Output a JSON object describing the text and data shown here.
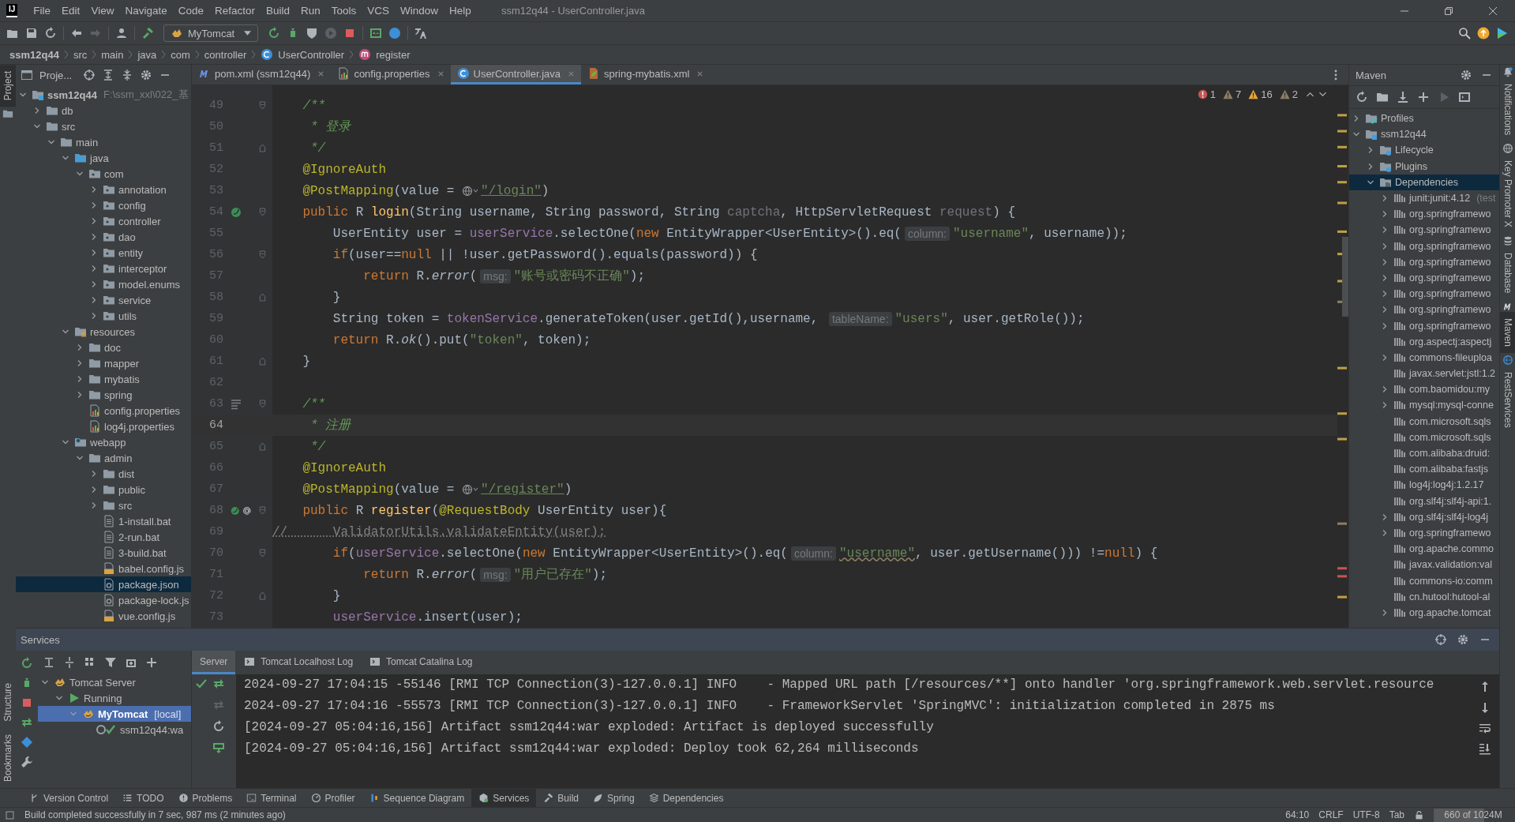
{
  "title_bar": {
    "logo": "IJ",
    "menu": [
      "File",
      "Edit",
      "View",
      "Navigate",
      "Code",
      "Refactor",
      "Build",
      "Run",
      "Tools",
      "VCS",
      "Window",
      "Help"
    ],
    "title": "ssm12q44 - UserController.java"
  },
  "toolbar": {
    "run_config": "MyTomcat"
  },
  "breadcrumb": [
    {
      "label": "ssm12q44",
      "kind": "root"
    },
    {
      "label": "src",
      "kind": "dir"
    },
    {
      "label": "main",
      "kind": "dir"
    },
    {
      "label": "java",
      "kind": "dir"
    },
    {
      "label": "com",
      "kind": "dir"
    },
    {
      "label": "controller",
      "kind": "dir"
    },
    {
      "label": "UserController",
      "kind": "class"
    },
    {
      "label": "register",
      "kind": "method"
    }
  ],
  "left_stripe": {
    "top": [
      {
        "label": "Project",
        "selected": true
      }
    ],
    "bottom": [
      {
        "label": "Structure",
        "selected": false
      },
      {
        "label": "Bookmarks",
        "selected": false
      }
    ]
  },
  "project": {
    "title": "Proje...",
    "tree": [
      {
        "label": "ssm12q44",
        "hint": "F:\\ssm_xxl\\022_基",
        "kind": "module",
        "expanded": true,
        "selected": false,
        "children": [
          {
            "label": "db",
            "kind": "folder",
            "expanded": false,
            "selected": false
          },
          {
            "label": "src",
            "kind": "folder",
            "expanded": true,
            "selected": false,
            "children": [
              {
                "label": "main",
                "kind": "folder",
                "expanded": true,
                "selected": false,
                "children": [
                  {
                    "label": "java",
                    "kind": "source",
                    "expanded": true,
                    "selected": false,
                    "children": [
                      {
                        "label": "com",
                        "kind": "package",
                        "expanded": true,
                        "selected": false,
                        "children": [
                          {
                            "label": "annotation",
                            "kind": "package",
                            "expanded": false,
                            "selected": false
                          },
                          {
                            "label": "config",
                            "kind": "package",
                            "expanded": false,
                            "selected": false
                          },
                          {
                            "label": "controller",
                            "kind": "package",
                            "expanded": false,
                            "selected": false
                          },
                          {
                            "label": "dao",
                            "kind": "package",
                            "expanded": false,
                            "selected": false
                          },
                          {
                            "label": "entity",
                            "kind": "package",
                            "expanded": false,
                            "selected": false
                          },
                          {
                            "label": "interceptor",
                            "kind": "package",
                            "expanded": false,
                            "selected": false
                          },
                          {
                            "label": "model.enums",
                            "kind": "package",
                            "expanded": false,
                            "selected": false
                          },
                          {
                            "label": "service",
                            "kind": "package",
                            "expanded": false,
                            "selected": false
                          },
                          {
                            "label": "utils",
                            "kind": "package",
                            "expanded": false,
                            "selected": false
                          }
                        ]
                      }
                    ]
                  },
                  {
                    "label": "resources",
                    "kind": "resources",
                    "expanded": true,
                    "selected": false,
                    "children": [
                      {
                        "label": "doc",
                        "kind": "folder",
                        "expanded": false,
                        "selected": false
                      },
                      {
                        "label": "mapper",
                        "kind": "folder",
                        "expanded": false,
                        "selected": false
                      },
                      {
                        "label": "mybatis",
                        "kind": "folder",
                        "expanded": false,
                        "selected": false
                      },
                      {
                        "label": "spring",
                        "kind": "folder",
                        "expanded": false,
                        "selected": false
                      },
                      {
                        "label": "config.properties",
                        "kind": "props",
                        "selected": false
                      },
                      {
                        "label": "log4j.properties",
                        "kind": "props",
                        "selected": false
                      }
                    ]
                  },
                  {
                    "label": "webapp",
                    "kind": "web",
                    "expanded": true,
                    "selected": false,
                    "children": [
                      {
                        "label": "admin",
                        "kind": "folder",
                        "expanded": true,
                        "selected": false,
                        "children": [
                          {
                            "label": "dist",
                            "kind": "folder",
                            "expanded": false,
                            "selected": false
                          },
                          {
                            "label": "public",
                            "kind": "folder",
                            "expanded": false,
                            "selected": false
                          },
                          {
                            "label": "src",
                            "kind": "folder",
                            "expanded": false,
                            "selected": false
                          },
                          {
                            "label": "1-install.bat",
                            "kind": "bat",
                            "selected": false
                          },
                          {
                            "label": "2-run.bat",
                            "kind": "bat",
                            "selected": false
                          },
                          {
                            "label": "3-build.bat",
                            "kind": "bat",
                            "selected": false
                          },
                          {
                            "label": "babel.config.js",
                            "kind": "js",
                            "selected": false
                          },
                          {
                            "label": "package.json",
                            "kind": "json",
                            "selected": true
                          },
                          {
                            "label": "package-lock.js",
                            "kind": "json",
                            "selected": false
                          },
                          {
                            "label": "vue.config.js",
                            "kind": "js",
                            "selected": false
                          }
                        ]
                      }
                    ]
                  }
                ]
              }
            ]
          }
        ]
      }
    ]
  },
  "tabs": [
    {
      "label": "pom.xml (ssm12q44)",
      "kind": "maven",
      "selected": false
    },
    {
      "label": "config.properties",
      "kind": "props",
      "selected": false
    },
    {
      "label": "UserController.java",
      "kind": "class",
      "selected": true
    },
    {
      "label": "spring-mybatis.xml",
      "kind": "spring",
      "selected": false
    }
  ],
  "inspections": [
    {
      "count": "1",
      "kind": "error"
    },
    {
      "count": "7",
      "kind": "weak"
    },
    {
      "count": "16",
      "kind": "warning"
    },
    {
      "count": "2",
      "kind": "weak"
    }
  ],
  "editor": {
    "lines": [
      {
        "number": "49",
        "fold_start": true,
        "current": false,
        "tokens": [
          {
            "text": "    /**",
            "kind": "doc"
          }
        ]
      },
      {
        "number": "50",
        "current": false,
        "tokens": [
          {
            "text": "     * 登录",
            "kind": "doc"
          }
        ]
      },
      {
        "number": "51",
        "fold_end": true,
        "current": false,
        "tokens": [
          {
            "text": "     */",
            "kind": "doc"
          }
        ]
      },
      {
        "number": "52",
        "current": false,
        "tokens": [
          {
            "text": "    @IgnoreAuth",
            "kind": "ann"
          }
        ]
      },
      {
        "number": "53",
        "current": false,
        "tokens": [
          {
            "text": "    @PostMapping",
            "kind": "ann"
          },
          {
            "text": "(value = ",
            "kind": "plain"
          },
          {
            "text": "\"/login\"",
            "kind": "url"
          },
          {
            "text": ")",
            "kind": "plain"
          }
        ]
      },
      {
        "number": "54",
        "gutter": [
          {
            "kind": "bean"
          }
        ],
        "fold_start": true,
        "current": false,
        "tokens": [
          {
            "text": "    public ",
            "kind": "kw"
          },
          {
            "text": "R ",
            "kind": "plain"
          },
          {
            "text": "login",
            "kind": "decl"
          },
          {
            "text": "(String username, String password, String ",
            "kind": "plain"
          },
          {
            "text": "captcha",
            "kind": "unused"
          },
          {
            "text": ", HttpServletRequest ",
            "kind": "plain"
          },
          {
            "text": "request",
            "kind": "unused"
          },
          {
            "text": ") {",
            "kind": "plain"
          }
        ]
      },
      {
        "number": "55",
        "current": false,
        "tokens": [
          {
            "text": "        UserEntity user = ",
            "kind": "plain"
          },
          {
            "text": "userService",
            "kind": "field"
          },
          {
            "text": ".selectOne(",
            "kind": "plain"
          },
          {
            "text": "new ",
            "kind": "kw"
          },
          {
            "text": "EntityWrapper<UserEntity>().eq(",
            "kind": "plain"
          },
          {
            "text": "column:",
            "kind": "hint"
          },
          {
            "text": "\"username\"",
            "kind": "str"
          },
          {
            "text": ", username));",
            "kind": "plain"
          }
        ]
      },
      {
        "number": "56",
        "fold_start": true,
        "current": false,
        "tokens": [
          {
            "text": "        if",
            "kind": "kw"
          },
          {
            "text": "(user==",
            "kind": "plain"
          },
          {
            "text": "null ",
            "kind": "kw"
          },
          {
            "text": "|| !user.getPassword().equals(password)) {",
            "kind": "plain"
          }
        ]
      },
      {
        "number": "57",
        "current": false,
        "tokens": [
          {
            "text": "            return ",
            "kind": "kw"
          },
          {
            "text": "R.",
            "kind": "plain"
          },
          {
            "text": "error",
            "kind": "static"
          },
          {
            "text": "(",
            "kind": "plain"
          },
          {
            "text": "msg:",
            "kind": "hint"
          },
          {
            "text": "\"账号或密码不正确\"",
            "kind": "str"
          },
          {
            "text": ");",
            "kind": "plain"
          }
        ]
      },
      {
        "number": "58",
        "fold_end": true,
        "current": false,
        "tokens": [
          {
            "text": "        }",
            "kind": "plain"
          }
        ]
      },
      {
        "number": "59",
        "current": false,
        "tokens": [
          {
            "text": "        String token = ",
            "kind": "plain"
          },
          {
            "text": "tokenService",
            "kind": "field"
          },
          {
            "text": ".generateToken(user.getId(),username, ",
            "kind": "plain"
          },
          {
            "text": "tableName:",
            "kind": "hint"
          },
          {
            "text": "\"users\"",
            "kind": "str"
          },
          {
            "text": ", user.getRole());",
            "kind": "plain"
          }
        ]
      },
      {
        "number": "60",
        "current": false,
        "tokens": [
          {
            "text": "        return ",
            "kind": "kw"
          },
          {
            "text": "R.",
            "kind": "plain"
          },
          {
            "text": "ok",
            "kind": "static"
          },
          {
            "text": "().put(",
            "kind": "plain"
          },
          {
            "text": "\"token\"",
            "kind": "str"
          },
          {
            "text": ", token);",
            "kind": "plain"
          }
        ]
      },
      {
        "number": "61",
        "fold_end": true,
        "current": false,
        "tokens": [
          {
            "text": "    }",
            "kind": "plain"
          }
        ]
      },
      {
        "number": "62",
        "current": false
      },
      {
        "number": "63",
        "gutter": [
          {
            "kind": "doc"
          }
        ],
        "fold_start": true,
        "current": false,
        "tokens": [
          {
            "text": "    /**",
            "kind": "doc"
          }
        ]
      },
      {
        "number": "64",
        "current": true,
        "tokens": [
          {
            "text": "     * 注册",
            "kind": "doc"
          }
        ]
      },
      {
        "number": "65",
        "fold_end": true,
        "current": false,
        "tokens": [
          {
            "text": "     */",
            "kind": "doc"
          }
        ]
      },
      {
        "number": "66",
        "current": false,
        "tokens": [
          {
            "text": "    @IgnoreAuth",
            "kind": "ann"
          }
        ]
      },
      {
        "number": "67",
        "current": false,
        "tokens": [
          {
            "text": "    @PostMapping",
            "kind": "ann"
          },
          {
            "text": "(value = ",
            "kind": "plain"
          },
          {
            "text": "\"/register\"",
            "kind": "url"
          },
          {
            "text": ")",
            "kind": "plain"
          }
        ]
      },
      {
        "number": "68",
        "gutter": [
          {
            "kind": "bean"
          },
          {
            "kind": "at"
          }
        ],
        "fold_start": true,
        "current": false,
        "tokens": [
          {
            "text": "    public ",
            "kind": "kw"
          },
          {
            "text": "R ",
            "kind": "plain"
          },
          {
            "text": "register",
            "kind": "decl"
          },
          {
            "text": "(",
            "kind": "plain"
          },
          {
            "text": "@RequestBody",
            "kind": "ann"
          },
          {
            "text": " UserEntity user){",
            "kind": "plain"
          }
        ]
      },
      {
        "number": "69",
        "current": false,
        "tokens": [
          {
            "text": "//      ValidatorUtils.validateEntity(user);",
            "kind": "comment"
          }
        ]
      },
      {
        "number": "70",
        "fold_start": true,
        "current": false,
        "tokens": [
          {
            "text": "        if",
            "kind": "kw"
          },
          {
            "text": "(",
            "kind": "plain"
          },
          {
            "text": "userService",
            "kind": "field"
          },
          {
            "text": ".selectOne(",
            "kind": "plain"
          },
          {
            "text": "new ",
            "kind": "kw"
          },
          {
            "text": "EntityWrapper<UserEntity>().eq(",
            "kind": "plain"
          },
          {
            "text": "column:",
            "kind": "hint"
          },
          {
            "text": "\"username\"",
            "kind": "strwarn"
          },
          {
            "text": ", user.getUsername())) !=",
            "kind": "plain"
          },
          {
            "text": "null",
            "kind": "kw"
          },
          {
            "text": ") {",
            "kind": "plain"
          }
        ]
      },
      {
        "number": "71",
        "current": false,
        "tokens": [
          {
            "text": "            return ",
            "kind": "kw"
          },
          {
            "text": "R.",
            "kind": "plain"
          },
          {
            "text": "error",
            "kind": "static"
          },
          {
            "text": "(",
            "kind": "plain"
          },
          {
            "text": "msg:",
            "kind": "hint"
          },
          {
            "text": "\"用户已存在\"",
            "kind": "str"
          },
          {
            "text": ");",
            "kind": "plain"
          }
        ]
      },
      {
        "number": "72",
        "fold_end": true,
        "current": false,
        "tokens": [
          {
            "text": "        }",
            "kind": "plain"
          }
        ]
      },
      {
        "number": "73",
        "current": false,
        "tokens": [
          {
            "text": "        userService",
            "kind": "field"
          },
          {
            "text": ".insert(user);",
            "kind": "plain"
          }
        ]
      }
    ]
  },
  "maven": {
    "title": "Maven",
    "tree": [
      {
        "label": "Profiles",
        "kind": "profiles",
        "expanded": false,
        "selected": false
      },
      {
        "label": "ssm12q44",
        "kind": "mvnmodule",
        "expanded": true,
        "selected": false,
        "children": [
          {
            "label": "Lifecycle",
            "kind": "lifecycle",
            "expanded": false,
            "selected": false
          },
          {
            "label": "Plugins",
            "kind": "lifecycle",
            "expanded": false,
            "selected": false
          },
          {
            "label": "Dependencies",
            "kind": "deps",
            "expanded": true,
            "selected": true,
            "children": [
              {
                "label": "junit:junit:4.12",
                "hint": "(test",
                "kind": "library",
                "expanded": false,
                "selected": false
              },
              {
                "label": "org.springframewo",
                "kind": "library",
                "expanded": false,
                "selected": false
              },
              {
                "label": "org.springframewo",
                "kind": "library",
                "expanded": false,
                "selected": false
              },
              {
                "label": "org.springframewo",
                "kind": "library",
                "expanded": false,
                "selected": false
              },
              {
                "label": "org.springframewo",
                "kind": "library",
                "expanded": false,
                "selected": false
              },
              {
                "label": "org.springframewo",
                "kind": "library",
                "expanded": false,
                "selected": false
              },
              {
                "label": "org.springframewo",
                "kind": "library",
                "expanded": false,
                "selected": false
              },
              {
                "label": "org.springframewo",
                "kind": "library",
                "expanded": false,
                "selected": false
              },
              {
                "label": "org.springframewo",
                "kind": "library",
                "expanded": false,
                "selected": false
              },
              {
                "label": "org.aspectj:aspectj",
                "kind": "library",
                "selected": false
              },
              {
                "label": "commons-fileuploa",
                "kind": "library",
                "expanded": false,
                "selected": false
              },
              {
                "label": "javax.servlet:jstl:1.2",
                "kind": "library",
                "selected": false
              },
              {
                "label": "com.baomidou:my",
                "kind": "library",
                "expanded": false,
                "selected": false
              },
              {
                "label": "mysql:mysql-conne",
                "kind": "library",
                "expanded": false,
                "selected": false
              },
              {
                "label": "com.microsoft.sqls",
                "kind": "library",
                "selected": false
              },
              {
                "label": "com.microsoft.sqls",
                "kind": "library",
                "selected": false
              },
              {
                "label": "com.alibaba:druid:",
                "kind": "library",
                "selected": false
              },
              {
                "label": "com.alibaba:fastjs",
                "kind": "library",
                "selected": false
              },
              {
                "label": "log4j:log4j:1.2.17",
                "kind": "library",
                "selected": false
              },
              {
                "label": "org.slf4j:slf4j-api:1.",
                "kind": "library",
                "selected": false
              },
              {
                "label": "org.slf4j:slf4j-log4j",
                "kind": "library",
                "expanded": false,
                "selected": false
              },
              {
                "label": "org.springframewo",
                "kind": "library",
                "expanded": false,
                "selected": false
              },
              {
                "label": "org.apache.commo",
                "kind": "library",
                "selected": false
              },
              {
                "label": "javax.validation:val",
                "kind": "library",
                "selected": false
              },
              {
                "label": "commons-io:comm",
                "kind": "library",
                "selected": false
              },
              {
                "label": "cn.hutool:hutool-al",
                "kind": "library",
                "selected": false
              },
              {
                "label": "org.apache.tomcat",
                "kind": "library",
                "expanded": false,
                "selected": false
              }
            ]
          }
        ]
      }
    ]
  },
  "right_stripe": [
    {
      "label": "Notifications",
      "kind": "bell",
      "selected": false
    },
    {
      "label": "Key Promoter X",
      "kind": "key",
      "selected": false
    },
    {
      "label": "Database",
      "kind": "db",
      "selected": false
    },
    {
      "label": "Maven",
      "kind": "maven",
      "selected": true
    },
    {
      "label": "RestServices",
      "kind": "rest",
      "selected": false
    }
  ],
  "services": {
    "title": "Services",
    "tree": [
      {
        "label": "Tomcat Server",
        "kind": "tomcat",
        "expanded": true,
        "selected": false,
        "children": [
          {
            "label": "Running",
            "kind": "run",
            "expanded": true,
            "selected": false,
            "children": [
              {
                "label": "MyTomcat",
                "hint": "[local]",
                "kind": "tomcat",
                "expanded": true,
                "selected": true,
                "children": [
                  {
                    "label": "ssm12q44:wa",
                    "kind": "artifact",
                    "selected": false
                  }
                ]
              }
            ]
          }
        ]
      }
    ],
    "tabs": [
      {
        "label": "Server",
        "selected": true
      },
      {
        "label": "Tomcat Localhost Log",
        "selected": false
      },
      {
        "label": "Tomcat Catalina Log",
        "selected": false
      }
    ],
    "log": [
      "2024-09-27 17:04:15 -55146 [RMI TCP Connection(3)-127.0.0.1] INFO    - Mapped URL path [/resources/**] onto handler 'org.springframework.web.servlet.resource",
      "2024-09-27 17:04:16 -55573 [RMI TCP Connection(3)-127.0.0.1] INFO    - FrameworkServlet 'SpringMVC': initialization completed in 2875 ms",
      "[2024-09-27 05:04:16,156] Artifact ssm12q44:war exploded: Artifact is deployed successfully",
      "[2024-09-27 05:04:16,156] Artifact ssm12q44:war exploded: Deploy took 62,264 milliseconds"
    ]
  },
  "tool_tabs": [
    {
      "label": "Version Control",
      "kind": "vcs",
      "selected": false
    },
    {
      "label": "TODO",
      "kind": "todo",
      "selected": false
    },
    {
      "label": "Problems",
      "kind": "problems",
      "selected": false
    },
    {
      "label": "Terminal",
      "kind": "terminal",
      "selected": false
    },
    {
      "label": "Profiler",
      "kind": "profiler",
      "selected": false
    },
    {
      "label": "Sequence Diagram",
      "kind": "sequence",
      "selected": false
    },
    {
      "label": "Services",
      "kind": "services",
      "selected": true
    },
    {
      "label": "Build",
      "kind": "build",
      "selected": false
    },
    {
      "label": "Spring",
      "kind": "spring",
      "selected": false
    },
    {
      "label": "Dependencies",
      "kind": "deps",
      "selected": false
    }
  ],
  "status_bar": {
    "message": "Build completed successfully in 7 sec, 987 ms (2 minutes ago)",
    "position": "64:10",
    "line_separator": "CRLF",
    "encoding": "UTF-8",
    "indent": "Tab",
    "memory": {
      "text": "660 of 1024M",
      "level": 0.64
    }
  }
}
